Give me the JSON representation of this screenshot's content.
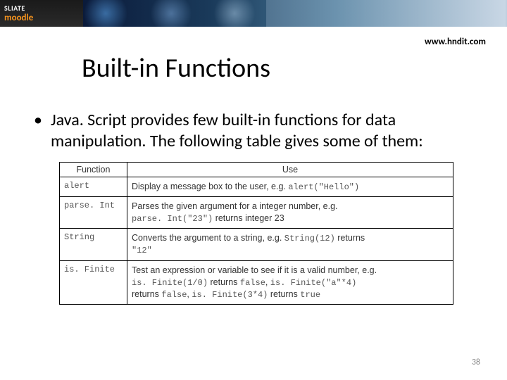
{
  "banner": {
    "logo_top": "SLIATE",
    "logo_bottom": "moodle"
  },
  "url": "www.hndit.com",
  "title": "Built-in Functions",
  "bullet": "Java. Script provides few built-in functions for data manipulation. The following table gives some of them:",
  "table": {
    "headers": [
      "Function",
      "Use"
    ],
    "rows": [
      {
        "fn": "alert",
        "use_pre": "Display a message box to the user, e.g. ",
        "use_code": "alert(\"Hello\")",
        "use_post": ""
      },
      {
        "fn": "parse. Int",
        "use_pre": "Parses the given argument for a integer number, e.g. ",
        "use_code": "parse. Int(\"23\")",
        "use_post": " returns integer 23"
      },
      {
        "fn": "String",
        "use_pre": "Converts the argument to a string, e.g. ",
        "use_code": "String(12)",
        "use_post": " returns ",
        "use_code2": "\"12\""
      },
      {
        "fn": "is. Finite",
        "use_pre": "Test an expression or variable to see if it is a valid number, e.g. ",
        "use_code": "is. Finite(1/0)",
        "use_mid1": " returns ",
        "use_code2": "false",
        "use_mid2": ", ",
        "use_code3": "is. Finite(\"a\"*4)",
        "use_mid3": " returns ",
        "use_code4": "false",
        "use_mid4": ", ",
        "use_code5": "is. Finite(3*4)",
        "use_mid5": " returns ",
        "use_code6": "true"
      }
    ]
  },
  "pagenum": "38"
}
